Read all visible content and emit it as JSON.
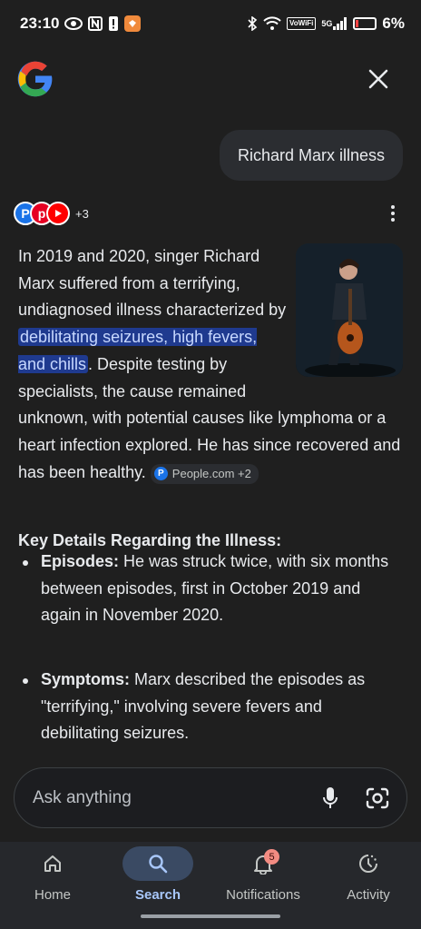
{
  "status_bar": {
    "time": "23:10",
    "network_label": "VoWiFi",
    "signal_label": "5G",
    "battery_percent": "6%"
  },
  "header": {
    "logo": "google-g-logo",
    "close_icon": "close-icon"
  },
  "query": {
    "text": "Richard Marx illness"
  },
  "sources": {
    "icons": [
      "P",
      "p",
      "youtube"
    ],
    "extra_count": "+3"
  },
  "answer": {
    "p1": "In 2019 and 2020, singer Richard Marx suffered from a terrifying, undiagnosed illness characterized by ",
    "highlight": "debilitating seizures, high fevers, and chills",
    "p2": ". Despite testing by specialists, the cause remained unknown, with potential causes like lymphoma or a heart infection explored. He has since recovered and has been healthy.",
    "citation": "People.com +2"
  },
  "key_details": {
    "heading": "Key Details Regarding the Illness:",
    "items": [
      {
        "label": "Episodes:",
        "text": " He was struck twice, with six months between episodes, first in October 2019 and again in November 2020."
      },
      {
        "label": "Symptoms:",
        "text": " Marx described the episodes as \"terrifying,\" involving severe fevers and debilitating seizures."
      }
    ]
  },
  "ask_bar": {
    "placeholder": "Ask anything",
    "mic_icon": "microphone-icon",
    "lens_icon": "lens-camera-icon"
  },
  "bottom_nav": {
    "items": [
      {
        "label": "Home",
        "icon": "home-icon"
      },
      {
        "label": "Search",
        "icon": "search-icon"
      },
      {
        "label": "Notifications",
        "icon": "bell-icon",
        "badge": "5"
      },
      {
        "label": "Activity",
        "icon": "activity-icon"
      }
    ],
    "active": "Search"
  },
  "colors": {
    "background": "#1f1f1f",
    "highlight": "#1f3a8f",
    "accent": "#a8c7fa"
  }
}
